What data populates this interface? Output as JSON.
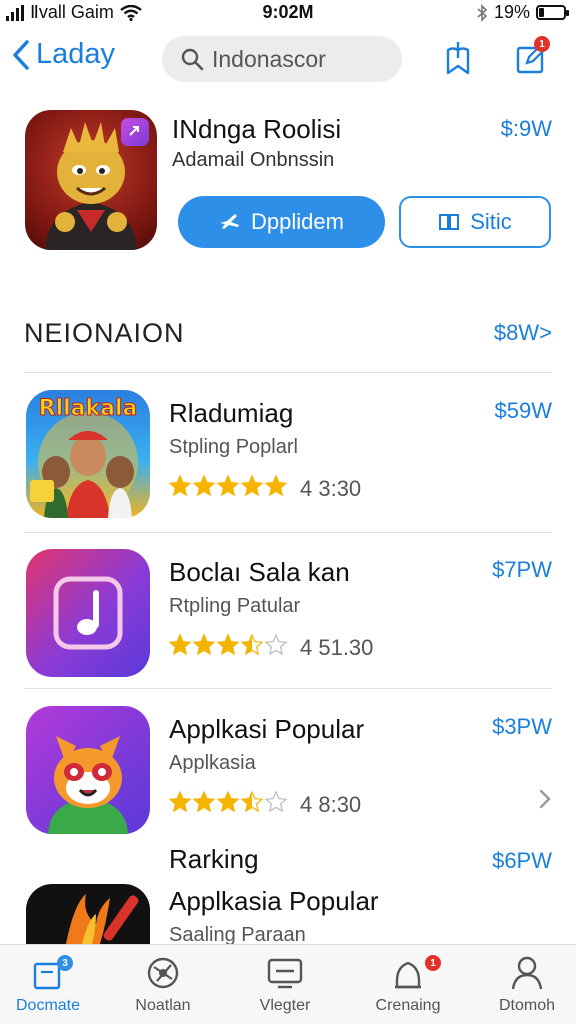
{
  "status_bar": {
    "carrier": "Ⅱvall Gaim",
    "time": "9:02M",
    "battery_percent": "19%",
    "battery_level": 0.19
  },
  "nav": {
    "back_label": "Laday",
    "search_placeholder": "Indonascor",
    "compose_badge": "1"
  },
  "featured": {
    "title": "INdnga Roolisi",
    "subtitle": "Adamail Onbnssin",
    "price": "$:9W",
    "primary_button": "Dpplidem",
    "secondary_button": "Sitic"
  },
  "section": {
    "title": "NEIONAION",
    "link": "$8W>"
  },
  "apps": [
    {
      "title": "Rladumiag",
      "subtitle": "Stpling Poplarl",
      "rating_text": "4 3:30",
      "stars": 5,
      "price": "$59W",
      "icon_text": "Rllakala"
    },
    {
      "title": "Boclaı Sala kan",
      "subtitle": "Rtpling Patular",
      "rating_text": "4 51.30",
      "stars": 3.5,
      "price": "$7PW"
    },
    {
      "title": "Applkasi Popular",
      "subtitle": "Applkasia",
      "rating_text": "4 8:30",
      "stars": 3.5,
      "price": "$3PW"
    },
    {
      "title": "Applkasia Popular",
      "subtitle": "Saaling Paraan",
      "price": "$6PW"
    }
  ],
  "ranking_label": "Rarking",
  "tabs": [
    {
      "label": "Docmate",
      "icon": "today-icon",
      "badge": "3",
      "active": true
    },
    {
      "label": "Noatlan",
      "icon": "games-icon",
      "active": false
    },
    {
      "label": "Vlegter",
      "icon": "apps-icon",
      "active": false
    },
    {
      "label": "Crenaing",
      "icon": "updates-icon",
      "badge": "1",
      "active": false
    },
    {
      "label": "Dtomoh",
      "icon": "account-icon",
      "active": false
    }
  ],
  "colors": {
    "accent": "#1a7fdc",
    "button": "#2d8fe8",
    "star": "#f5b400",
    "badge": "#e0322b"
  }
}
